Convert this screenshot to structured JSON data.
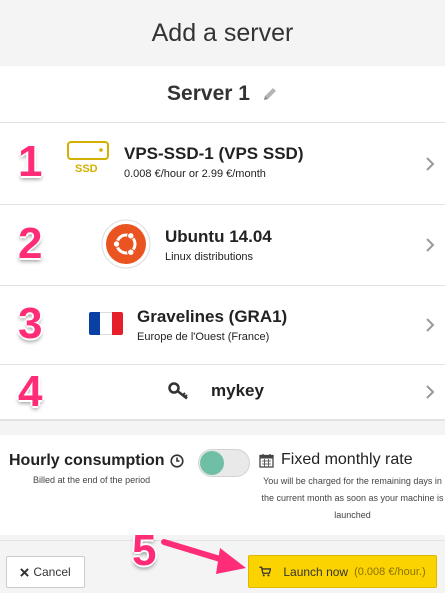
{
  "header": {
    "title": "Add a server"
  },
  "server": {
    "name": "Server 1"
  },
  "steps": {
    "s1": "1",
    "s2": "2",
    "s3": "3",
    "s4": "4",
    "s5": "5"
  },
  "model": {
    "badge": "SSD",
    "title": "VPS-SSD-1 (VPS SSD)",
    "subtitle": "0.008 €/hour or 2.99 €/month"
  },
  "os": {
    "title": "Ubuntu 14.04",
    "subtitle": "Linux distributions"
  },
  "location": {
    "title": "Gravelines (GRA1)",
    "subtitle": "Europe de l'Ouest (France)"
  },
  "key": {
    "title": "mykey"
  },
  "billing": {
    "hourly_title": "Hourly consumption",
    "hourly_sub": "Billed at the end of the period",
    "fixed_title": "Fixed monthly rate",
    "fixed_sub": "You will be charged for the remaining days in the current month as soon as your machine is launched",
    "hourly_selected": true
  },
  "footer": {
    "cancel_label": "Cancel",
    "launch_label": "Launch now",
    "launch_price": "(0.008 €/hour.)"
  },
  "colors": {
    "accent_pink": "#ff2d78",
    "launch_yellow": "#fbd300",
    "toggle_green": "#6fbfa7",
    "ssd_gold": "#d4b000",
    "ubuntu_orange": "#e95420"
  },
  "icons": [
    "pencil-icon",
    "ssd-drive-icon",
    "ubuntu-logo",
    "france-flag",
    "key-icon",
    "chevron-right-icon",
    "clock-icon",
    "calendar-icon",
    "times-icon",
    "cart-icon",
    "arrow-icon"
  ]
}
